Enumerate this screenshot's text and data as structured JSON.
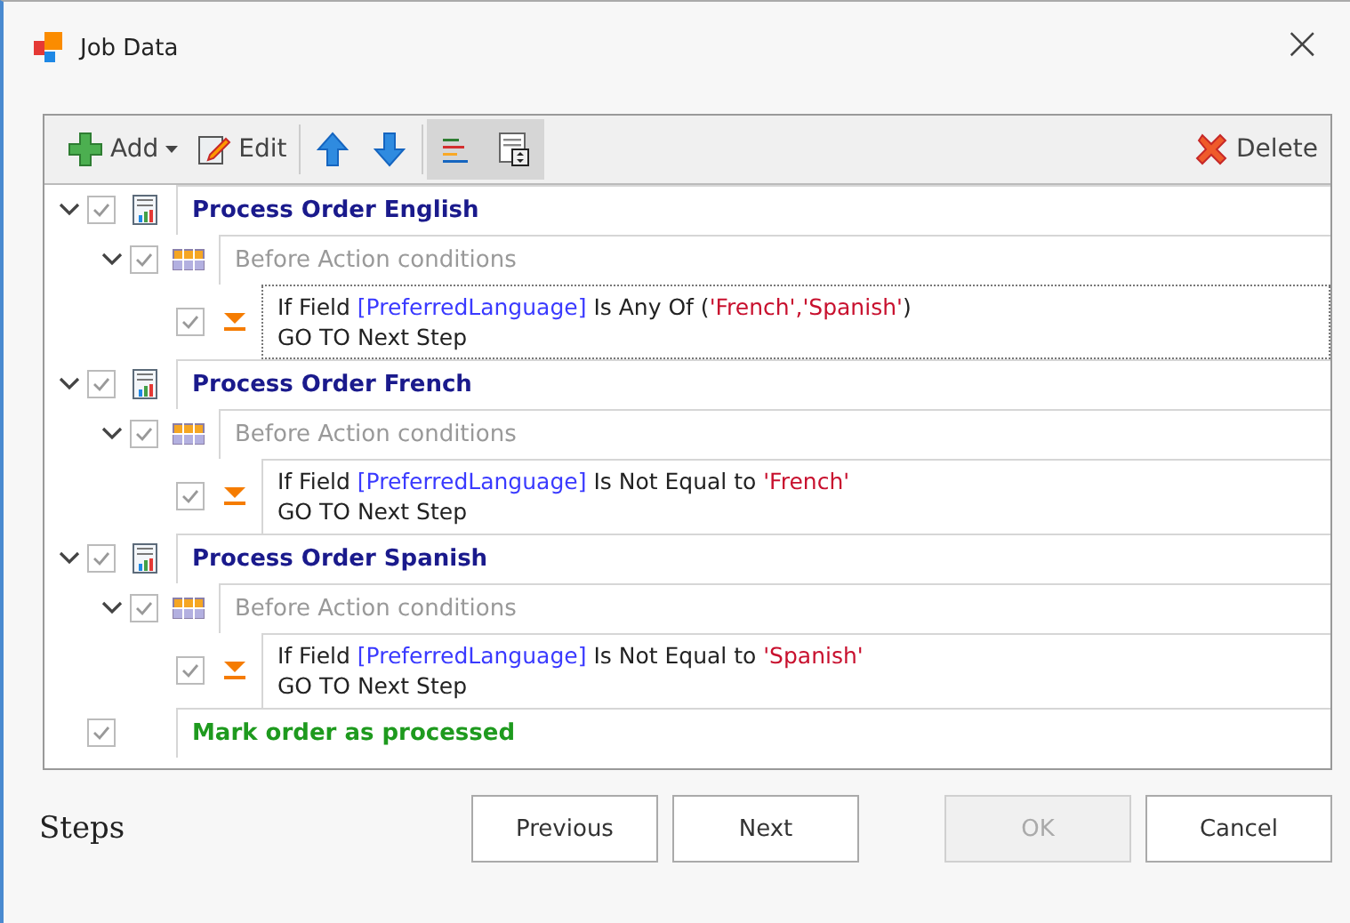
{
  "window": {
    "title": "Job Data",
    "close": "×"
  },
  "toolbar": {
    "left": [
      {
        "kind": "add",
        "label": "Add",
        "dropdown": true
      },
      {
        "kind": "edit",
        "label": "Edit"
      },
      {
        "kind": "sep"
      },
      {
        "kind": "up"
      },
      {
        "kind": "down"
      },
      {
        "kind": "sep"
      },
      {
        "kind": "align-toggle",
        "on": true
      },
      {
        "kind": "form-toggle",
        "on": true
      }
    ],
    "delete": "Delete"
  },
  "steps": [
    {
      "kind": "process",
      "title": "Process Order English",
      "checked": true,
      "expanded": true,
      "children": [
        {
          "title": "Before Action conditions",
          "checked": true,
          "expanded": true,
          "children": [
            {
              "checked": true,
              "selected": true,
              "line1": [
                {
                  "kind": "text",
                  "text": "If Field "
                },
                {
                  "kind": "field",
                  "text": "[PreferredLanguage]"
                },
                {
                  "kind": "text",
                  "text": " Is Any Of ("
                },
                {
                  "kind": "value",
                  "text": "'French','Spanish'"
                },
                {
                  "kind": "text",
                  "text": ")"
                }
              ],
              "line2": "GO TO Next Step"
            }
          ]
        }
      ]
    },
    {
      "kind": "process",
      "title": "Process Order French",
      "checked": true,
      "expanded": true,
      "children": [
        {
          "title": "Before Action conditions",
          "checked": true,
          "expanded": true,
          "children": [
            {
              "checked": true,
              "selected": false,
              "line1": [
                {
                  "kind": "text",
                  "text": "If Field "
                },
                {
                  "kind": "field",
                  "text": "[PreferredLanguage]"
                },
                {
                  "kind": "text",
                  "text": " Is Not Equal to "
                },
                {
                  "kind": "value",
                  "text": "'French'"
                }
              ],
              "line2": "GO TO Next Step"
            }
          ]
        }
      ]
    },
    {
      "kind": "process",
      "title": "Process Order Spanish",
      "checked": true,
      "expanded": true,
      "children": [
        {
          "title": "Before Action conditions",
          "checked": true,
          "expanded": true,
          "children": [
            {
              "checked": true,
              "selected": false,
              "line1": [
                {
                  "kind": "text",
                  "text": "If Field "
                },
                {
                  "kind": "field",
                  "text": "[PreferredLanguage]"
                },
                {
                  "kind": "text",
                  "text": " Is Not Equal to "
                },
                {
                  "kind": "value",
                  "text": "'Spanish'"
                }
              ],
              "line2": "GO TO Next Step"
            }
          ]
        }
      ]
    },
    {
      "kind": "action",
      "title": "Mark order as processed",
      "checked": true,
      "expanded": false
    }
  ],
  "footer": {
    "label": "Steps",
    "buttons": [
      {
        "label": "Previous",
        "disabled": false
      },
      {
        "label": "Next",
        "disabled": false
      },
      {
        "label": "OK",
        "disabled": true
      },
      {
        "label": "Cancel",
        "disabled": false
      }
    ]
  }
}
